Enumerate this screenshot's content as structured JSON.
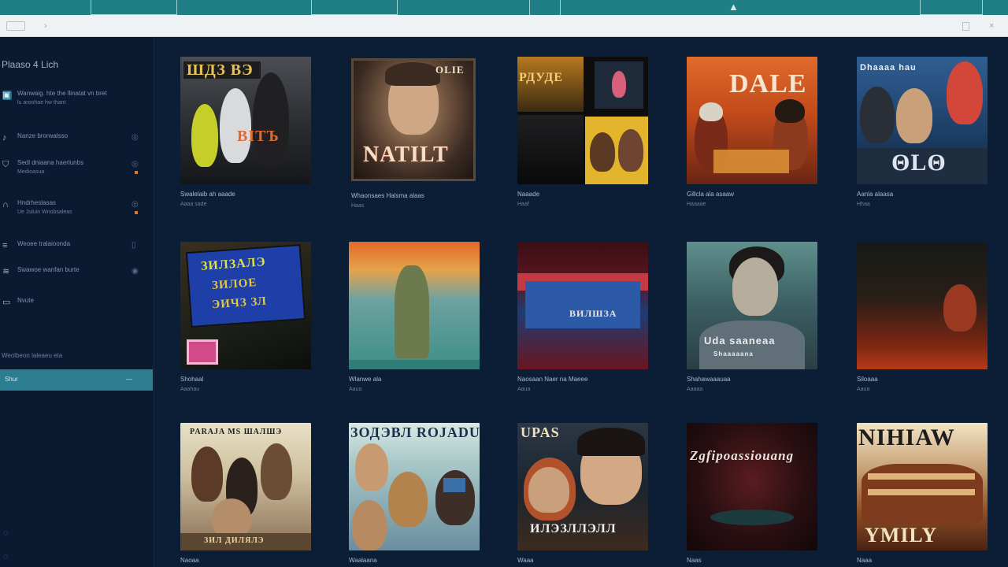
{
  "window": {
    "toolbar": {
      "back_icon": "back-icon",
      "forward_glyph": "›",
      "close_glyph": "×"
    }
  },
  "sidebar": {
    "title": "Plaaso 4 Lich",
    "items": [
      {
        "label": "Wanwaig. hte the llinatat vn bret",
        "sub": "lu aroohae hw thant",
        "icon": "library-icon",
        "right": "",
        "dot": false
      },
      {
        "label": "Nanze brorwalsso",
        "sub": "",
        "icon": "music-icon",
        "right": "◎",
        "dot": false
      },
      {
        "label": "Sedl dniaana haerlunbs",
        "sub": "Medioasua",
        "icon": "shield-icon",
        "right": "◎",
        "dot": true
      },
      {
        "label": "Hndrheslasas",
        "sub": "Ue Juluin Wnobsaleas",
        "icon": "headphones-icon",
        "right": "◎",
        "dot": true
      },
      {
        "label": "Weoee tralaioonda",
        "sub": "",
        "icon": "playlist-icon",
        "right": "▯",
        "dot": false
      },
      {
        "label": "Swawoe wanfan burte",
        "sub": "",
        "icon": "radio-icon",
        "right": "◉",
        "dot": false
      },
      {
        "label": "Nvute",
        "sub": "",
        "icon": "tv-icon",
        "right": "",
        "dot": false
      }
    ],
    "section_label": "Weolbeon laleaeu eta",
    "progress": {
      "label": "Shur",
      "end_glyph": "—"
    }
  },
  "grid": {
    "cards": [
      {
        "title": "Swalelaib ah aaade",
        "sub": "Aaaa sade",
        "cover_text": [
          "ШДЗ ВЭ",
          "ВІТЪ"
        ]
      },
      {
        "title": "Whaonsaes Halsma alaas",
        "sub": "Haas",
        "cover_text": [
          "OLIE",
          "NATILT"
        ]
      },
      {
        "title": "Naaade",
        "sub": "Haaf",
        "cover_text": [
          "РДУДЕ"
        ]
      },
      {
        "title": "Gillcla ala asaaw",
        "sub": "Haaaae",
        "cover_text": [
          "DALE"
        ]
      },
      {
        "title": "Aanla alaasa",
        "sub": "Hhaa",
        "cover_text": [
          "Dhaaaa hau",
          "ΘLΘ"
        ]
      },
      {
        "title": "Shohaal",
        "sub": "Aaahau",
        "cover_text": [
          "ЗИЛЗАЛЭ",
          "ЗИЛОЕ",
          "ЭИЧЗ ЗЛ"
        ]
      },
      {
        "title": "Wlanwe ala",
        "sub": "Aaua",
        "cover_text": []
      },
      {
        "title": "Naosaan Naer na Maeee",
        "sub": "Aaua",
        "cover_text": [
          "ВИЛШЗА"
        ]
      },
      {
        "title": "Shahawaaauaa",
        "sub": "Aaaaa",
        "cover_text": [
          "Uda saaneaa",
          "Shaaaaana"
        ]
      },
      {
        "title": "Siloaaa",
        "sub": "Aaua",
        "cover_text": []
      },
      {
        "title": "Naoaa",
        "sub": "",
        "cover_text": [
          "PARAJA MS ШАЛШЭ",
          "ЗИЛ ДИЛЯЛЭ"
        ]
      },
      {
        "title": "Waalaana",
        "sub": "",
        "cover_text": [
          "ЗОДЭВЛ ROJADU"
        ]
      },
      {
        "title": "Waaa",
        "sub": "",
        "cover_text": [
          "UPAS",
          "ИЛЭЗЛЛЭЛЛ"
        ]
      },
      {
        "title": "Naas",
        "sub": "",
        "cover_text": [
          "Zgfipoassiouang"
        ]
      },
      {
        "title": "Naaa",
        "sub": "",
        "cover_text": [
          "NIHIAW",
          "YMILY"
        ]
      }
    ]
  },
  "footer_icons": [
    "help-icon",
    "settings-icon"
  ]
}
